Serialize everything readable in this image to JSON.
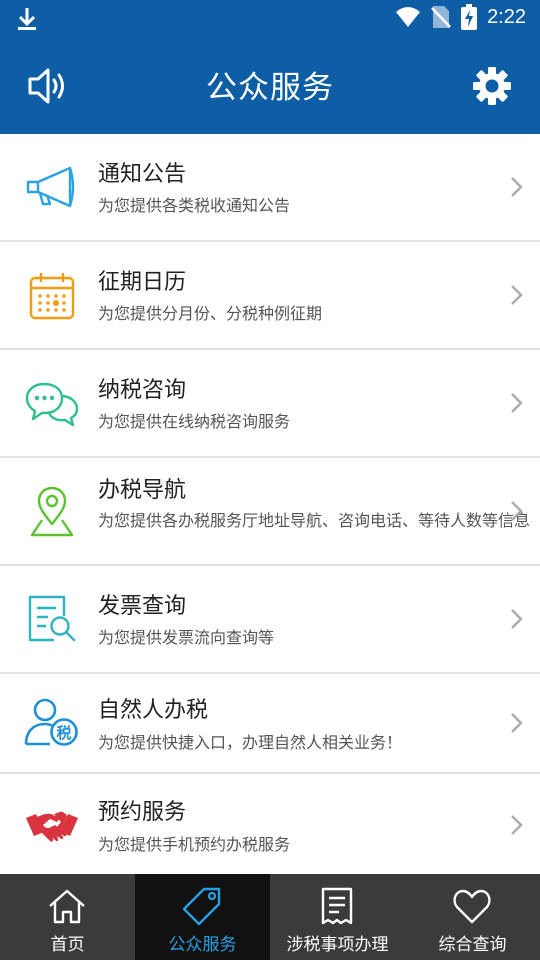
{
  "status_bar": {
    "time": "2:22"
  },
  "app_bar": {
    "title": "公众服务"
  },
  "services": [
    {
      "title": "通知公告",
      "subtitle": "为您提供各类税收通知公告",
      "icon": "megaphone-icon"
    },
    {
      "title": "征期日历",
      "subtitle": "为您提供分月份、分税种例征期",
      "icon": "calendar-icon"
    },
    {
      "title": "纳税咨询",
      "subtitle": "为您提供在线纳税咨询服务",
      "icon": "chat-bubbles-icon"
    },
    {
      "title": "办税导航",
      "subtitle": "为您提供各办税服务厅地址导航、咨询电话、等待人数等信息",
      "icon": "map-pin-icon"
    },
    {
      "title": "发票查询",
      "subtitle": "为您提供发票流向查询等",
      "icon": "document-search-icon"
    },
    {
      "title": "自然人办税",
      "subtitle": "为您提供快捷入口，办理自然人相关业务！",
      "icon": "person-tax-icon",
      "badge": "税"
    },
    {
      "title": "预约服务",
      "subtitle": "为您提供手机预约办税服务",
      "icon": "handshake-icon"
    }
  ],
  "tabs": [
    {
      "label": "首页",
      "icon": "home-icon",
      "active": false
    },
    {
      "label": "公众服务",
      "icon": "tag-icon",
      "active": true
    },
    {
      "label": "涉税事项办理",
      "icon": "receipt-icon",
      "active": false
    },
    {
      "label": "综合查询",
      "icon": "heart-icon",
      "active": false
    }
  ],
  "colors": {
    "header_bg": "#0e5ea6",
    "tab_bar_bg": "#3b3b3b",
    "tab_active_bg": "#111111",
    "tab_active_text": "#27a1e6",
    "icon_blue": "#29a3e3",
    "icon_orange": "#f39c12",
    "icon_green": "#2ebf8a",
    "icon_lime": "#5cc22f",
    "icon_red": "#d9333f"
  }
}
